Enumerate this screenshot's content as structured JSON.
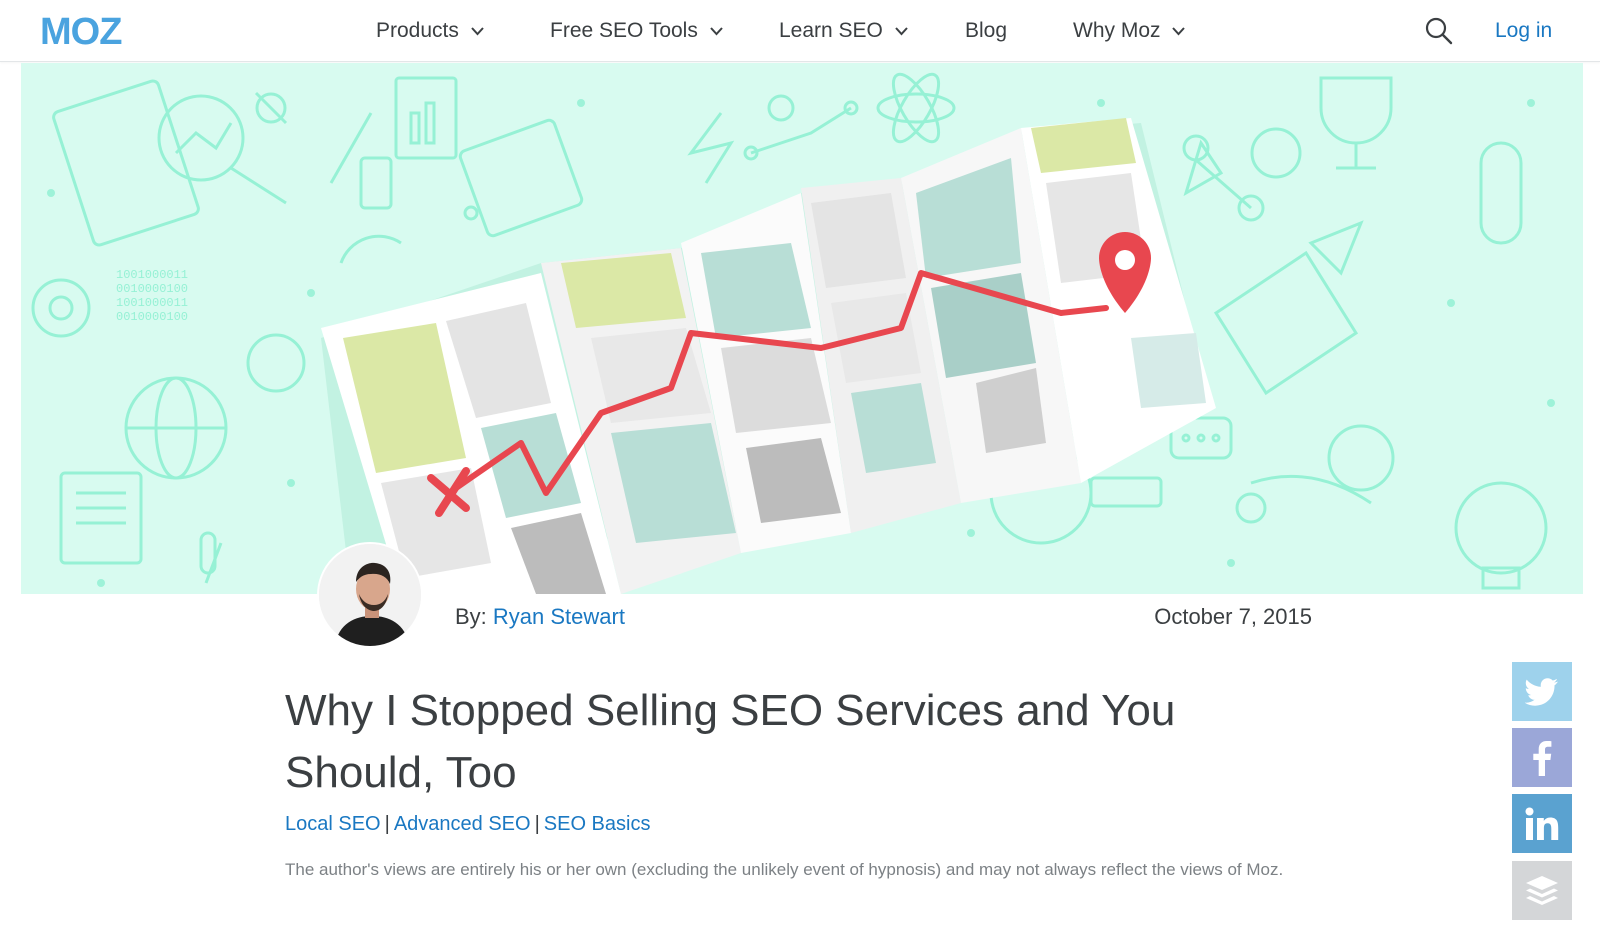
{
  "brand": {
    "name": "MOZ",
    "accent": "#4aa3df",
    "link_color": "#1a78c2"
  },
  "header": {
    "nav": [
      {
        "label": "Products",
        "has_dropdown": true
      },
      {
        "label": "Free SEO Tools",
        "has_dropdown": true
      },
      {
        "label": "Learn SEO",
        "has_dropdown": true
      },
      {
        "label": "Blog",
        "has_dropdown": false
      },
      {
        "label": "Why Moz",
        "has_dropdown": true
      }
    ],
    "search_icon": "search-icon",
    "login_label": "Log in"
  },
  "hero": {
    "background_color": "#d8fbf0",
    "illustration": "folded-map-with-route-and-pin",
    "route_color": "#e8474f"
  },
  "article": {
    "byline_prefix": "By: ",
    "author": "Ryan Stewart",
    "date": "October 7, 2015",
    "title": "Why I Stopped Selling SEO Services and You Should, Too",
    "categories": [
      "Local SEO",
      "Advanced SEO",
      "SEO Basics"
    ],
    "category_separator": "|",
    "disclaimer": "The author's views are entirely his or her own (excluding the unlikely event of hypnosis) and may not always reflect the views of Moz."
  },
  "social": [
    {
      "network": "twitter",
      "icon": "twitter-icon",
      "color": "#9ed2ec"
    },
    {
      "network": "facebook",
      "icon": "facebook-icon",
      "color": "#9ba7d8"
    },
    {
      "network": "linkedin",
      "icon": "linkedin-icon",
      "color": "#5aa2d0"
    },
    {
      "network": "buffer",
      "icon": "buffer-icon",
      "color": "#d4d6d8"
    }
  ]
}
